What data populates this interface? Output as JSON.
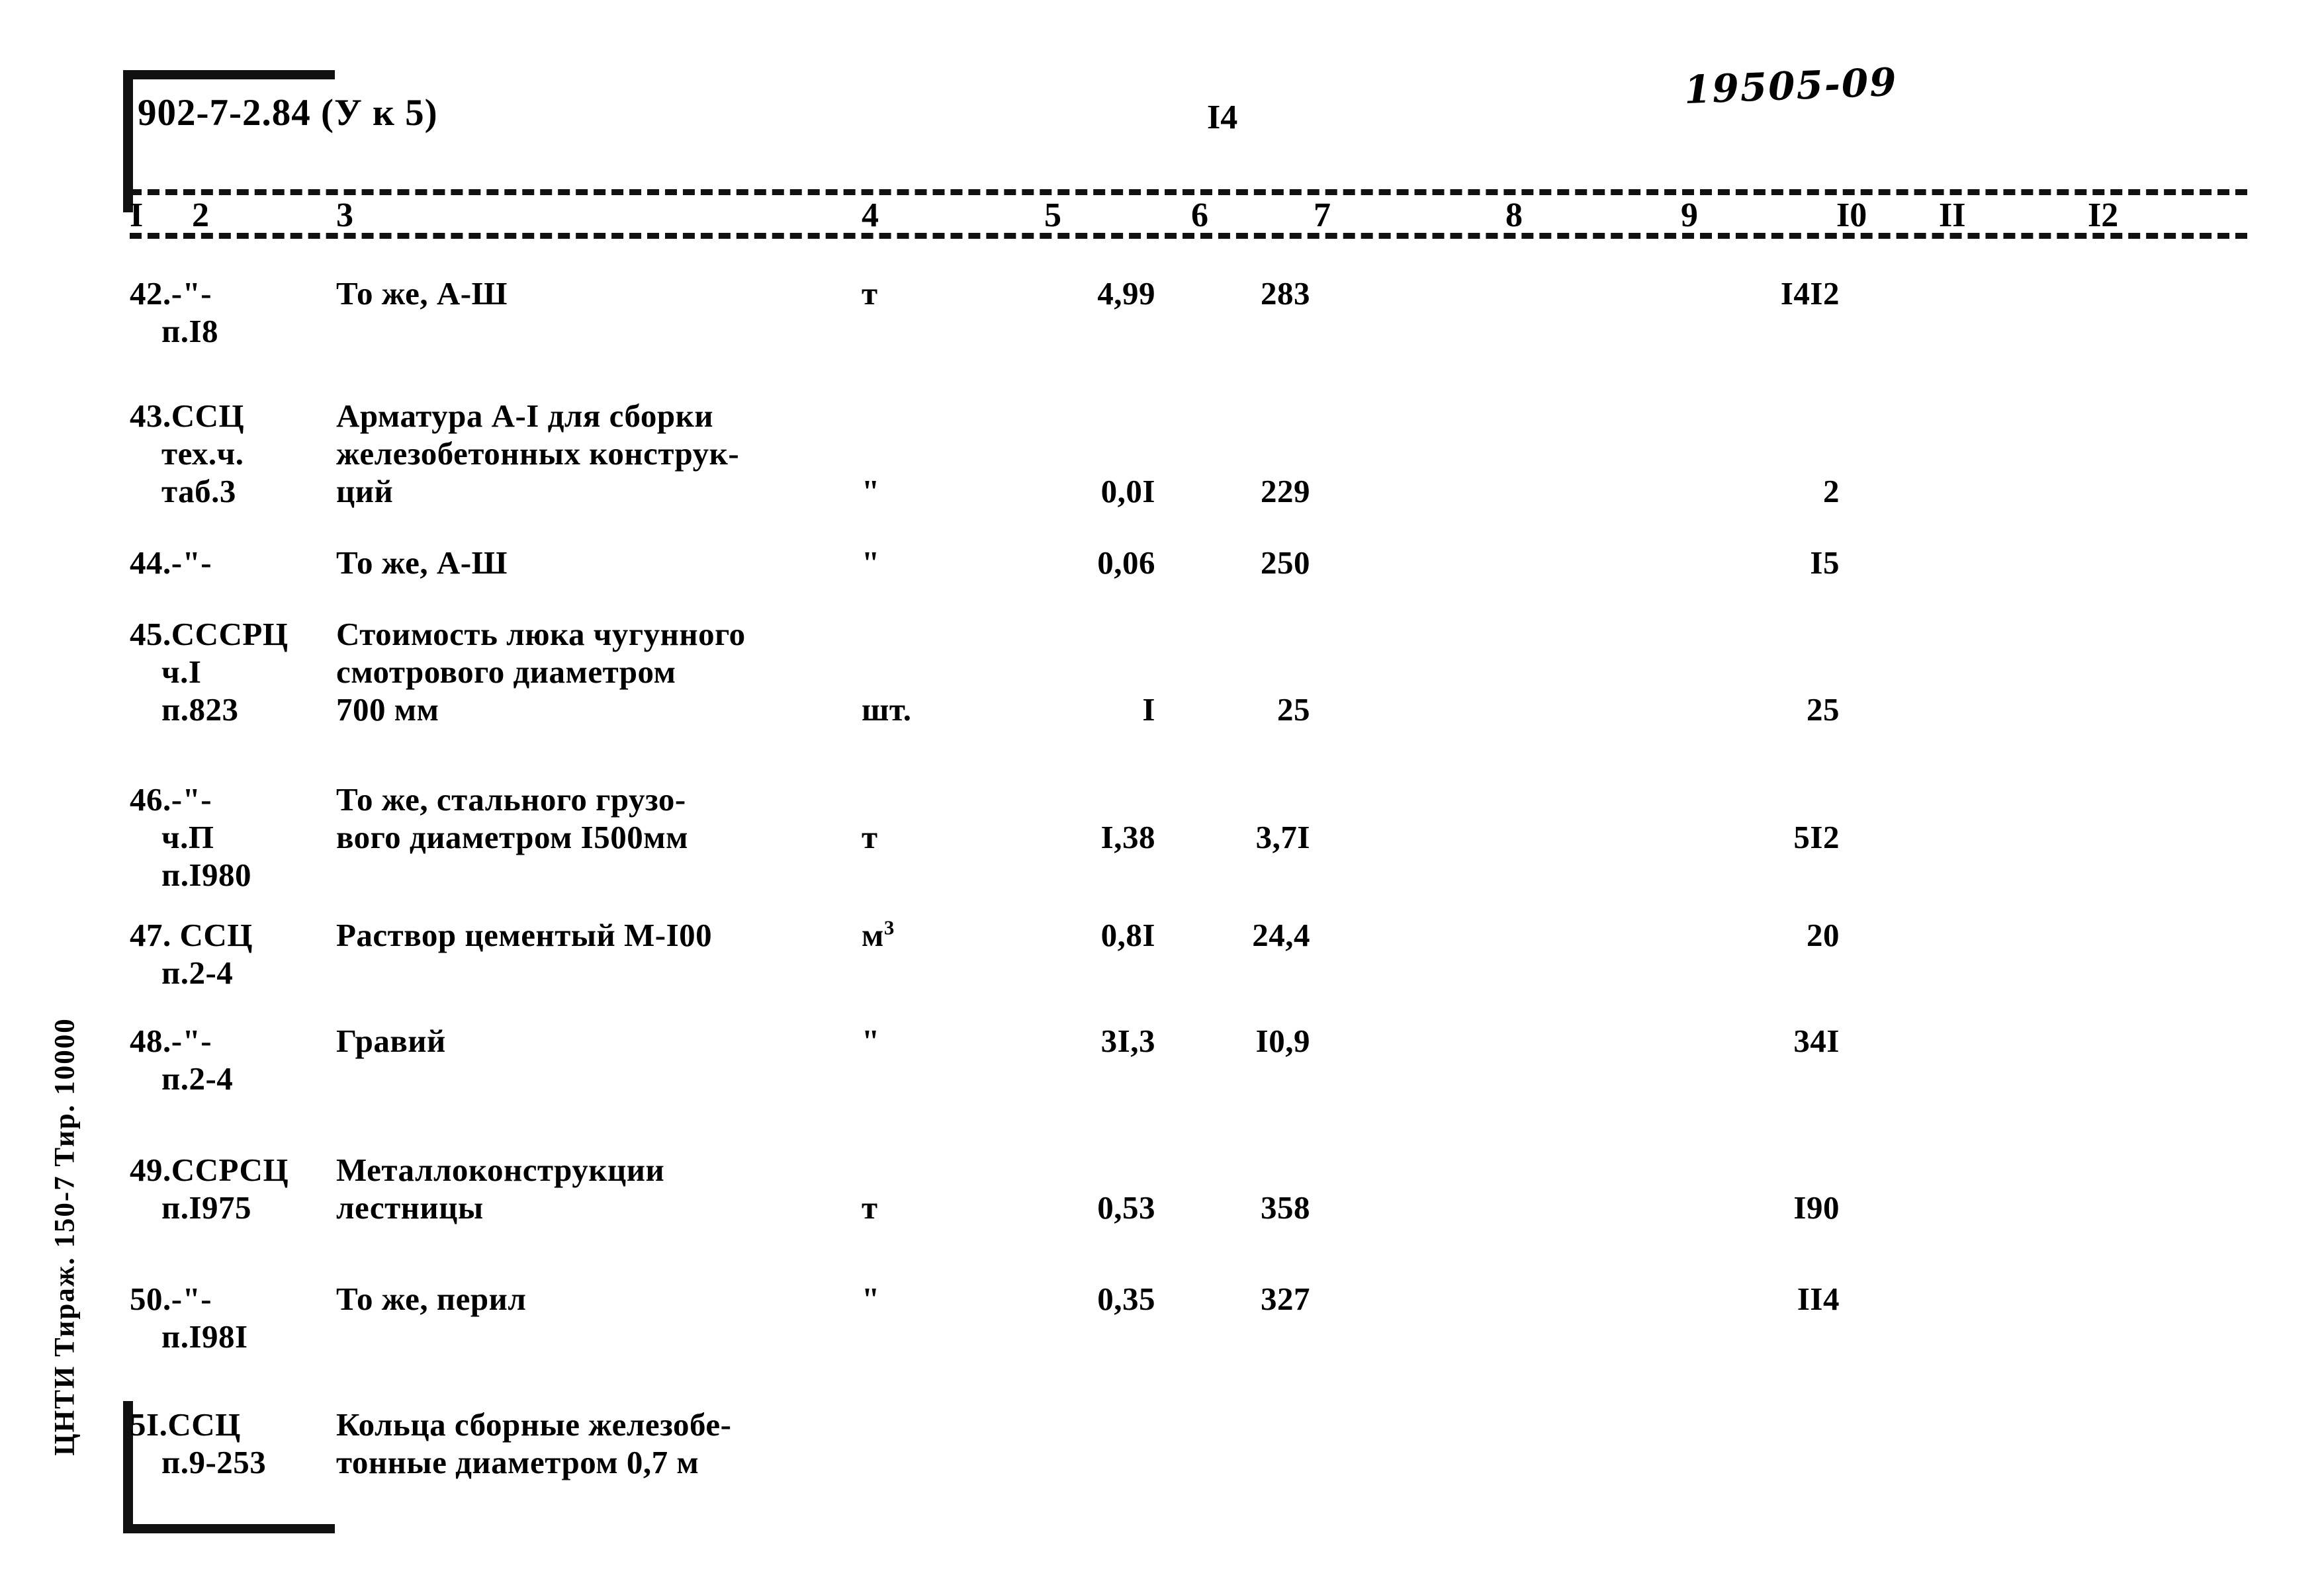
{
  "header": {
    "doc_code": "902-7-2.84 (У к 5)",
    "page_number": "I4",
    "handwritten_number": "19505-09"
  },
  "table": {
    "column_numbers": [
      "I",
      "2",
      "3",
      "4",
      "5",
      "6",
      "7",
      "8",
      "9",
      "I0",
      "II",
      "I2"
    ],
    "rows": [
      {
        "pos": "42.-\"-",
        "ref": "п.I8",
        "name_lines": [
          "То же, А-Ш"
        ],
        "unit": "т",
        "qty": "4,99",
        "price": "283",
        "total": "I4I2"
      },
      {
        "pos": "43.ССЦ",
        "ref": "тех.ч.",
        "ref2": "таб.3",
        "name_lines": [
          "Арматура А-I для сборки",
          "железобетонных конструк-",
          "ций"
        ],
        "unit": "\"",
        "qty": "0,0I",
        "price": "229",
        "total": "2"
      },
      {
        "pos": "44.-\"-",
        "ref": "",
        "name_lines": [
          "То же, А-Ш"
        ],
        "unit": "\"",
        "qty": "0,06",
        "price": "250",
        "total": "I5"
      },
      {
        "pos": "45.СССРЦ",
        "ref": "ч.I",
        "ref2": "п.823",
        "name_lines": [
          "Стоимость люка чугунного",
          "смотрового диаметром",
          "700 мм"
        ],
        "unit": "шт.",
        "qty": "I",
        "price": "25",
        "total": "25"
      },
      {
        "pos": "46.-\"-",
        "ref": "ч.П",
        "ref2": "п.I980",
        "name_lines": [
          "То же, стального грузо-",
          "вого диаметром I500мм"
        ],
        "unit": "т",
        "qty": "I,38",
        "price": "3,7I",
        "total": "5I2"
      },
      {
        "pos": "47. ССЦ",
        "ref": "п.2-4",
        "name_lines": [
          "Раствор цементый М-I00"
        ],
        "unit": "м",
        "unit_sup": "3",
        "qty": "0,8I",
        "price": "24,4",
        "total": "20"
      },
      {
        "pos": "48.-\"-",
        "ref": "п.2-4",
        "name_lines": [
          "Гравий"
        ],
        "unit": "\"",
        "qty": "3I,3",
        "price": "I0,9",
        "total": "34I"
      },
      {
        "pos": "49.ССРСЦ",
        "ref": "п.I975",
        "name_lines": [
          "Металлоконструкции",
          "лестницы"
        ],
        "unit": "т",
        "qty": "0,53",
        "price": "358",
        "total": "I90"
      },
      {
        "pos": "50.-\"-",
        "ref": "п.I98I",
        "name_lines": [
          "То же, перил"
        ],
        "unit": "\"",
        "qty": "0,35",
        "price": "327",
        "total": "II4"
      },
      {
        "pos": "5I.ССЦ",
        "ref": "п.9-253",
        "name_lines": [
          "Кольца сборные железобе-",
          "тонные диаметром 0,7 м"
        ],
        "unit": "",
        "qty": "",
        "price": "",
        "total": ""
      }
    ]
  },
  "side_imprint": "ЦНТИ Тираж. 150-7 Тир. 10000"
}
